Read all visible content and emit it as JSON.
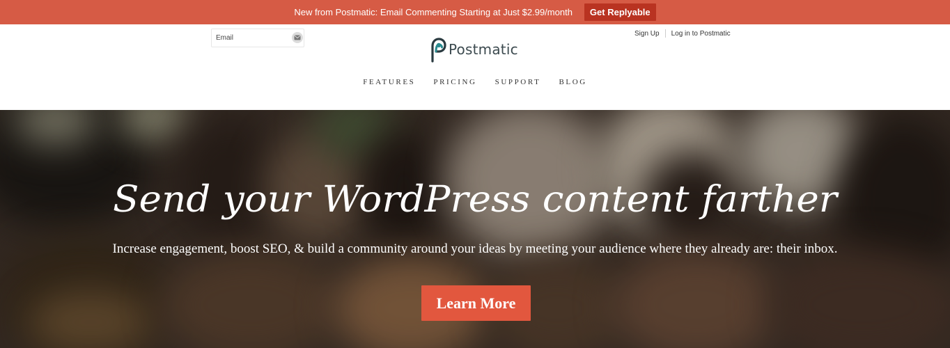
{
  "promo": {
    "text": "New from Postmatic: Email Commenting Starting at Just $2.99/month",
    "button_label": "Get Replyable"
  },
  "header": {
    "email_placeholder": "Email",
    "submit_icon": "envelope-icon",
    "logo_text": "Postmatic",
    "sign_up": "Sign Up",
    "log_in": "Log in to Postmatic"
  },
  "nav": {
    "items": [
      "FEATURES",
      "PRICING",
      "SUPPORT",
      "BLOG"
    ]
  },
  "hero": {
    "title": "Send your WordPress content farther",
    "subtitle": "Increase engagement, boost SEO, & build a community around your ideas by meeting your audience where they already are: their inbox.",
    "cta_label": "Learn More"
  },
  "colors": {
    "promo_bg": "#d65b45",
    "promo_button": "#b93321",
    "cta": "#e2573e",
    "logo_accent": "#2a8a8f"
  }
}
